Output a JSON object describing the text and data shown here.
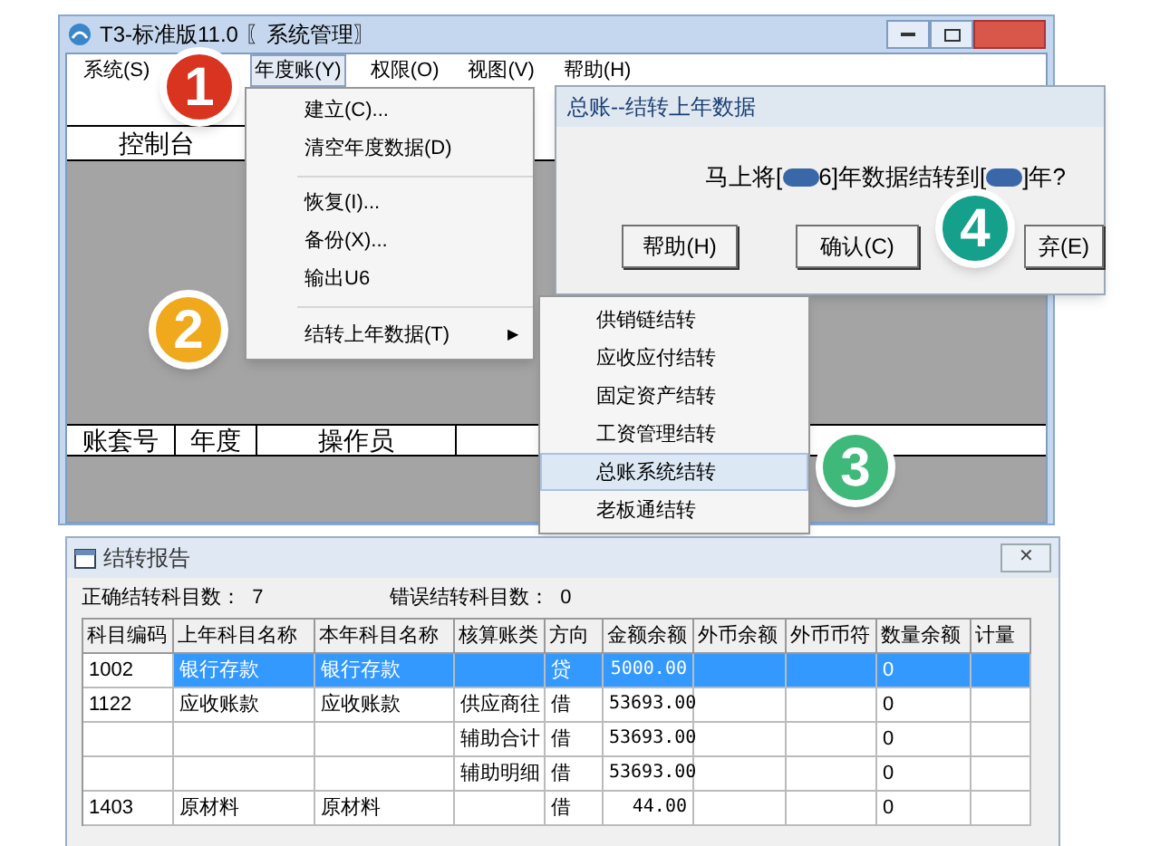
{
  "main_window": {
    "title": "T3-标准版11.0 〖系统管理〗",
    "menu": [
      {
        "label": "系统(S)",
        "selected": false
      },
      {
        "label": "年度账(Y)",
        "selected": true
      },
      {
        "label": "权限(O)",
        "selected": false
      },
      {
        "label": "视图(V)",
        "selected": false
      },
      {
        "label": "帮助(H)",
        "selected": false
      }
    ],
    "top_header": "控制台",
    "bottom_columns": [
      "账套号",
      "年度",
      "操作员"
    ]
  },
  "year_menu": [
    {
      "kind": "item",
      "label": "建立(C)..."
    },
    {
      "kind": "item",
      "label": "清空年度数据(D)"
    },
    {
      "kind": "separator"
    },
    {
      "kind": "item",
      "label": "恢复(I)..."
    },
    {
      "kind": "item",
      "label": "备份(X)..."
    },
    {
      "kind": "item",
      "label": "输出U6"
    },
    {
      "kind": "separator"
    },
    {
      "kind": "submenu",
      "label": "结转上年数据(T)",
      "arrow": "▶"
    }
  ],
  "carry_menu": [
    {
      "label": "供销链结转",
      "selected": false
    },
    {
      "label": "应收应付结转",
      "selected": false
    },
    {
      "label": "固定资产结转",
      "selected": false
    },
    {
      "label": "工资管理结转",
      "selected": false
    },
    {
      "label": "总账系统结转",
      "selected": true
    },
    {
      "label": "老板通结转",
      "selected": false
    }
  ],
  "dialog": {
    "title": "总账--结转上年数据",
    "message": [
      {
        "kind": "text",
        "text": "马上将["
      },
      {
        "kind": "redacted"
      },
      {
        "kind": "text",
        "text": "6]年数据结转到["
      },
      {
        "kind": "redacted"
      },
      {
        "kind": "text",
        "text": "]年?"
      }
    ],
    "buttons": [
      "帮助(H)",
      "确认(C)",
      "弃(E)"
    ]
  },
  "report": {
    "title": "结转报告",
    "close": "✕",
    "summary": [
      {
        "label": "正确结转科目数：",
        "value": "7"
      },
      {
        "label": "错误结转科目数：",
        "value": "0"
      }
    ],
    "columns": [
      "科目编码",
      "上年科目名称",
      "本年科目名称",
      "核算账类",
      "方向",
      "金额余额",
      "外币余额",
      "外币币符",
      "数量余额",
      "计量"
    ],
    "rows": [
      {
        "selected": true,
        "cells": [
          "1002",
          "银行存款",
          "银行存款",
          "",
          "贷",
          "5000.00",
          "",
          "",
          "0",
          ""
        ]
      },
      {
        "selected": false,
        "cells": [
          "1122",
          "应收账款",
          "应收账款",
          "供应商往",
          "借",
          "53693.00",
          "",
          "",
          "0",
          ""
        ]
      },
      {
        "selected": false,
        "cells": [
          "",
          "",
          "",
          "辅助合计",
          "借",
          "53693.00",
          "",
          "",
          "0",
          ""
        ]
      },
      {
        "selected": false,
        "cells": [
          "",
          "",
          "",
          "辅助明细",
          "借",
          "53693.00",
          "",
          "",
          "0",
          ""
        ]
      },
      {
        "selected": false,
        "cells": [
          "1403",
          "原材料",
          "原材料",
          "",
          "借",
          "44.00",
          "",
          "",
          "0",
          ""
        ]
      }
    ]
  },
  "badges": [
    {
      "label": "1",
      "color": "#d9341f"
    },
    {
      "label": "2",
      "color": "#f0a81c"
    },
    {
      "label": "3",
      "color": "#3fb97a"
    },
    {
      "label": "4",
      "color": "#14a08a"
    }
  ]
}
